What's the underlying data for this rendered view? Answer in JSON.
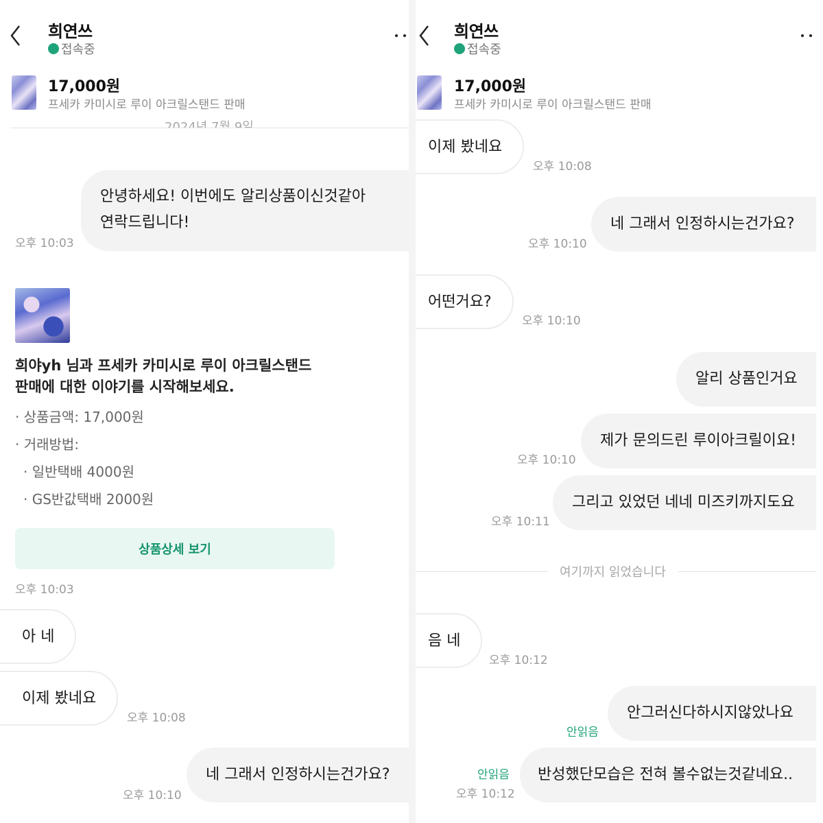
{
  "left": {
    "header": {
      "title": "희연쓰",
      "status": "접속중"
    },
    "product": {
      "price": "17,000원",
      "name": "프세카 카미시로 루이 아크릴스탠드 판매"
    },
    "date": "2024년 7월 9일",
    "messages": [
      {
        "text": "안녕하세요! 이번에도 알리상품이신것같아",
        "text2": "연락드립니다!",
        "time": "오후 10:03"
      },
      {
        "text": "아 네"
      },
      {
        "text": "이제 봤네요",
        "time": "오후 10:08"
      },
      {
        "text": "네 그래서 인정하시는건가요?",
        "time": "오후 10:10"
      }
    ],
    "card": {
      "title_line1": "희야yh 님과 프세카 카미시로 루이 아크릴스탠드",
      "title_line2": "판매에 대한 이야기를 시작해보세요.",
      "price_line": "· 상품금액: 17,000원",
      "method_label": "· 거래방법:",
      "method1": "· 일반택배 4000원",
      "method2": "· GS반값택배 2000원",
      "button": "상품상세 보기",
      "time": "오후 10:03"
    }
  },
  "right": {
    "header": {
      "title": "희연쓰",
      "status": "접속중"
    },
    "product": {
      "price": "17,000원",
      "name": "프세카 카미시로 루이 아크릴스탠드 판매"
    },
    "messages": [
      {
        "text": "이제 봤네요",
        "time": "오후 10:08"
      },
      {
        "text": "네 그래서 인정하시는건가요?",
        "time": "오후 10:10"
      },
      {
        "text": "어떤거요?",
        "time": "오후 10:10"
      },
      {
        "text": "알리 상품인거요"
      },
      {
        "text": "제가 문의드린 루이아크릴이요!",
        "time": "오후 10:10"
      },
      {
        "text": "그리고 있었던 네네 미즈키까지도요",
        "time": "오후 10:11"
      },
      {
        "text": "음 네",
        "time": "오후 10:12"
      },
      {
        "text": "안그러신다하시지않았나요",
        "unread": "안읽음"
      },
      {
        "text": "반성했단모습은 전혀 볼수없는것같네요..",
        "unread": "안읽음",
        "time": "오후 10:12"
      }
    ],
    "read_divider": "여기까지 읽었습니다"
  },
  "colors": {
    "accent": "#1fa37a",
    "bubble_out": "#f3f3f3",
    "card_button_bg": "#e8f7f2"
  }
}
